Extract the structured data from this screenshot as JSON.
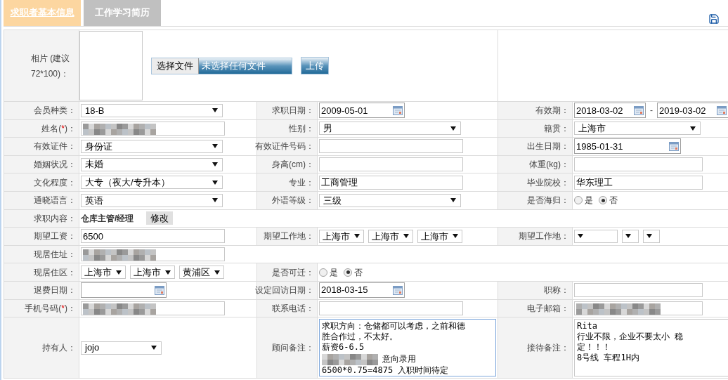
{
  "tabs": [
    {
      "label": "求职者基本信息",
      "selected": true
    },
    {
      "label": "工作学习简历",
      "selected": false
    }
  ],
  "photo": {
    "label": "相片 (建议72*100)：",
    "choose_button": "选择文件",
    "file_status": "未选择任何文件",
    "upload_button": "上传"
  },
  "rows": [
    {
      "cells": [
        {
          "label": "会员种类：",
          "field": {
            "kind": "select",
            "value": "18-B"
          }
        },
        {
          "label": "求职日期：",
          "field": {
            "kind": "date",
            "value": "2009-05-01"
          }
        },
        {
          "label": "有效期：",
          "field": {
            "kind": "date_range",
            "from": "2018-03-02",
            "separator": "-",
            "to": "2019-03-02"
          }
        }
      ]
    },
    {
      "cells": [
        {
          "label": "姓名(",
          "required_mark": "*",
          "label_tail": ")：",
          "field": {
            "kind": "input",
            "redacted": true
          }
        },
        {
          "label": "性别：",
          "field": {
            "kind": "select",
            "value": "男"
          }
        },
        {
          "label": "籍贯：",
          "field": {
            "kind": "select",
            "value": "上海市"
          }
        }
      ]
    },
    {
      "cells": [
        {
          "label": "有效证件：",
          "field": {
            "kind": "select",
            "value": "身份证"
          }
        },
        {
          "label": "有效证件号码：",
          "field": {
            "kind": "input"
          }
        },
        {
          "label": "出生日期：",
          "field": {
            "kind": "date",
            "value": "1985-01-31"
          }
        }
      ]
    },
    {
      "cells": [
        {
          "label": "婚姻状况：",
          "field": {
            "kind": "select",
            "value": "未婚"
          }
        },
        {
          "label": "身高(cm)：",
          "field": {
            "kind": "input"
          }
        },
        {
          "label": "体重(kg)：",
          "field": {
            "kind": "input"
          }
        }
      ]
    },
    {
      "cells": [
        {
          "label": "文化程度：",
          "field": {
            "kind": "select",
            "value": "大专（夜大/专升本）"
          }
        },
        {
          "label": "专业：",
          "field": {
            "kind": "input",
            "value": "工商管理"
          }
        },
        {
          "label": "毕业院校：",
          "field": {
            "kind": "input",
            "value": "华东理工"
          }
        }
      ]
    },
    {
      "cells": [
        {
          "label": "通晓语言：",
          "field": {
            "kind": "select",
            "value": "英语"
          }
        },
        {
          "label": "外语等级：",
          "field": {
            "kind": "select",
            "value": "三级"
          }
        },
        {
          "label": "是否海归：",
          "field": {
            "kind": "radio",
            "options": [
              {
                "label": "是",
                "selected": false
              },
              {
                "label": "否",
                "selected": true
              }
            ]
          }
        }
      ]
    },
    {
      "cells": [
        {
          "label": "求职内容：",
          "field": {
            "kind": "text_button",
            "text": "仓库主管/经理",
            "button": "修改"
          }
        }
      ]
    },
    {
      "cells": [
        {
          "label": "期望工资：",
          "field": {
            "kind": "input",
            "value": "6500"
          }
        },
        {
          "label": "期望工作地：",
          "field": {
            "kind": "select_group",
            "items": [
              {
                "kind": "select",
                "value": "上海市"
              },
              {
                "kind": "select",
                "value": "上海市"
              },
              {
                "kind": "select",
                "value": "上海市"
              }
            ]
          }
        },
        {
          "label": "期望工作地：",
          "field": {
            "kind": "select_group",
            "items": [
              {
                "kind": "select"
              },
              {
                "kind": "select"
              },
              {
                "kind": "select"
              }
            ]
          }
        }
      ]
    },
    {
      "cells": [
        {
          "label": "现居住址：",
          "field": {
            "kind": "input",
            "redacted": true
          }
        }
      ]
    },
    {
      "cells": [
        {
          "label": "现居住区：",
          "field": {
            "kind": "select_group",
            "items": [
              {
                "kind": "select",
                "value": "上海市"
              },
              {
                "kind": "select",
                "value": "上海市"
              },
              {
                "kind": "select",
                "value": "黄浦区"
              }
            ]
          }
        },
        {
          "label": "是否可迁：",
          "field": {
            "kind": "radio",
            "options": [
              {
                "label": "是",
                "selected": false
              },
              {
                "label": "否",
                "selected": true
              }
            ]
          }
        }
      ]
    },
    {
      "cells": [
        {
          "label": "退费日期：",
          "field": {
            "kind": "date"
          }
        },
        {
          "label": "设定回访日期：",
          "field": {
            "kind": "date",
            "value": "2018-03-15"
          }
        },
        {
          "label": "职称：",
          "field": {
            "kind": "input"
          }
        }
      ]
    },
    {
      "cells": [
        {
          "label": "手机号码(",
          "required_mark": "*",
          "label_tail": ")：",
          "field": {
            "kind": "input",
            "redacted": true
          }
        },
        {
          "label": "联系电话：",
          "field": {
            "kind": "input"
          }
        },
        {
          "label": "电子邮箱：",
          "field": {
            "kind": "input",
            "redacted": true
          }
        }
      ]
    },
    {
      "cells": [
        {
          "label": "持有人：",
          "field": {
            "kind": "select",
            "value": "jojo"
          }
        },
        {
          "label": "顾问备注：",
          "field": {
            "kind": "textarea",
            "focused": true,
            "lines": [
              {
                "text": "求职方向：仓储都可以考虑，之前和德"
              },
              {
                "text": "胜合作过，不太好。"
              },
              {
                "text": "薪资6-6.5"
              },
              {
                "redacted": true,
                "text": "意向录用"
              },
              {
                "text": "6500*0.75=4875 入职时间待定"
              }
            ]
          }
        },
        {
          "label": "接待备注：",
          "field": {
            "kind": "textarea",
            "focused": false,
            "lines": [
              {
                "text": "Rita"
              },
              {
                "text": "行业不限，企业不要太小 稳"
              },
              {
                "text": "定！！！"
              },
              {
                "text": "8号线 车程1H内"
              }
            ]
          }
        }
      ]
    }
  ]
}
